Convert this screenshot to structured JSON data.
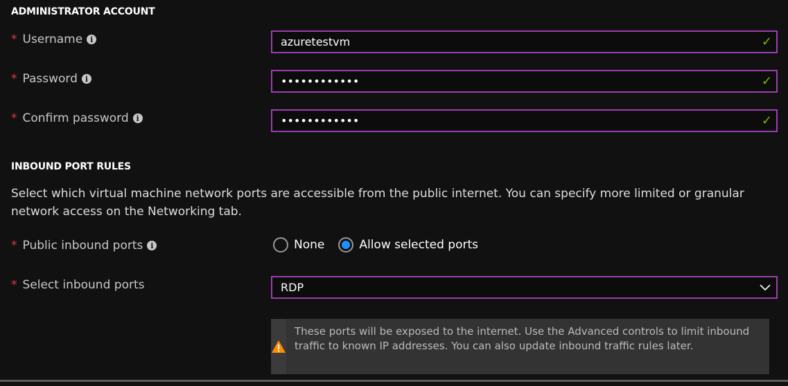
{
  "admin": {
    "title": "ADMINISTRATOR ACCOUNT",
    "username": {
      "label": "Username",
      "value": "azuretestvm"
    },
    "password": {
      "label": "Password",
      "value": "••••••••••••"
    },
    "confirm": {
      "label": "Confirm password",
      "value": "••••••••••••"
    }
  },
  "inbound": {
    "title": "INBOUND PORT RULES",
    "description": "Select which virtual machine network ports are accessible from the public internet. You can specify more limited or granular network access on the Networking tab.",
    "public_label": "Public inbound ports",
    "options": [
      "None",
      "Allow selected ports"
    ],
    "selected_option": "Allow selected ports",
    "select_label": "Select inbound ports",
    "select_value": "RDP",
    "warning": "These ports will be exposed to the internet. Use the Advanced controls to limit inbound traffic to known IP addresses. You can also update inbound traffic rules later."
  },
  "colors": {
    "accent_border": "#9b3fae",
    "valid": "#7fba00",
    "required": "#e8334a",
    "radio": "#1e90ff",
    "warning": "#ff8c00"
  }
}
